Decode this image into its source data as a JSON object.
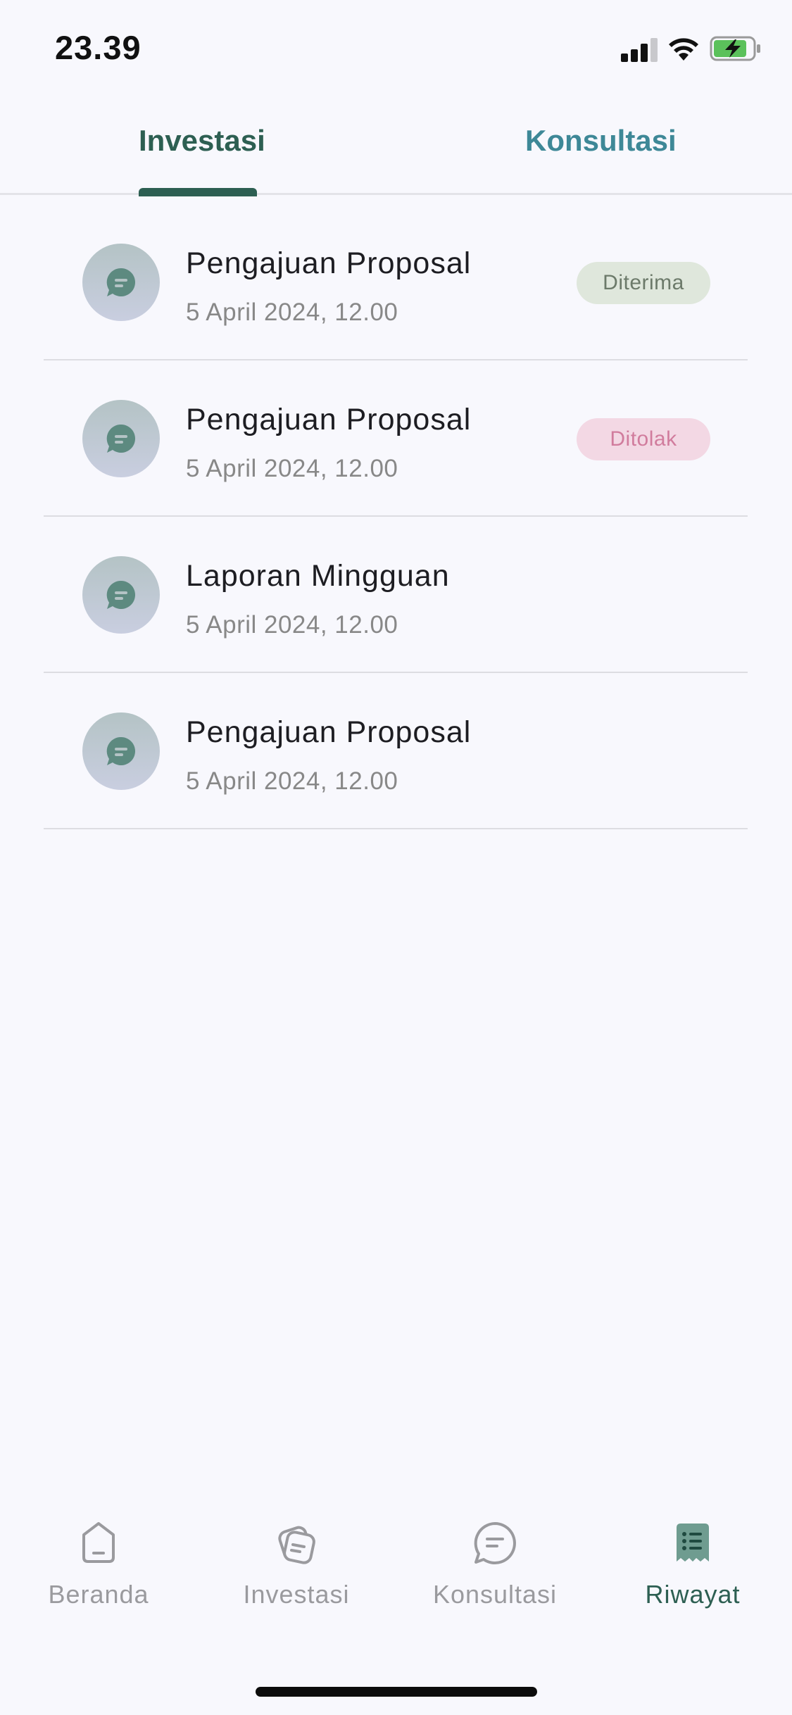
{
  "status_bar": {
    "time": "23.39",
    "icons": [
      "signal-icon",
      "wifi-icon",
      "battery-charging-icon"
    ],
    "battery_color": "#5bc15b"
  },
  "tabs": [
    {
      "label": "Investasi",
      "active": true
    },
    {
      "label": "Konsultasi",
      "active": false
    }
  ],
  "history": {
    "items": [
      {
        "title": "Pengajuan Proposal",
        "date": "5 April 2024, 12.00",
        "status": "Diterima",
        "icon": "chat-bubble-icon"
      },
      {
        "title": "Pengajuan Proposal",
        "date": "5 April 2024, 12.00",
        "status": "Ditolak",
        "icon": "chat-bubble-icon"
      },
      {
        "title": "Laporan Mingguan",
        "date": "5 April 2024, 12.00",
        "status": "",
        "icon": "chat-bubble-icon"
      },
      {
        "title": "Pengajuan Proposal",
        "date": "5 April 2024, 12.00",
        "status": "",
        "icon": "chat-bubble-icon"
      }
    ]
  },
  "bottom_nav": {
    "items": [
      {
        "label": "Beranda",
        "icon": "home-icon",
        "active": false
      },
      {
        "label": "Investasi",
        "icon": "investment-icon",
        "active": false
      },
      {
        "label": "Konsultasi",
        "icon": "chat-icon",
        "active": false
      },
      {
        "label": "Riwayat",
        "icon": "receipt-list-icon",
        "active": true
      }
    ]
  },
  "colors": {
    "primary": "#2d5f52",
    "secondary": "#3e8897",
    "accepted_bg": "#dfe7dc",
    "rejected_bg": "#f3d8e4",
    "background": "#f8f8fd"
  }
}
